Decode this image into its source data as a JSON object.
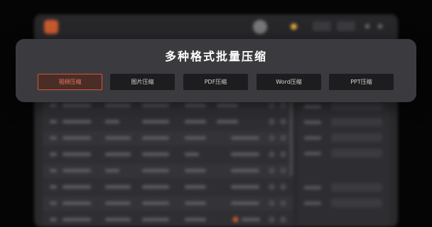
{
  "modal": {
    "title": "多种格式批量压缩",
    "formats": [
      {
        "label": "视频压缩",
        "selected": true
      },
      {
        "label": "图片压缩",
        "selected": false
      },
      {
        "label": "PDF压缩",
        "selected": false
      },
      {
        "label": "Word压缩",
        "selected": false
      },
      {
        "label": "PPT压缩",
        "selected": false
      }
    ]
  },
  "colors": {
    "accent": "#d0553b",
    "modal_bg": "#3b3b3f",
    "button_bg": "#1d1d1f",
    "page_bg": "#050505"
  }
}
